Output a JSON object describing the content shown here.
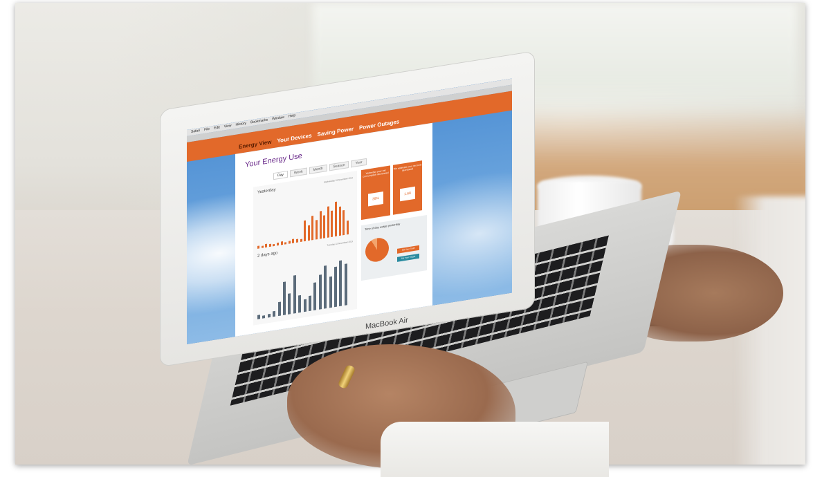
{
  "browser": {
    "menu": [
      "Safari",
      "File",
      "Edit",
      "View",
      "History",
      "Bookmarks",
      "Window",
      "Help"
    ]
  },
  "site": {
    "nav": [
      "Energy View",
      "Your Devices",
      "Saving Power",
      "Power Outages"
    ],
    "active_nav": "Energy View"
  },
  "panel": {
    "title": "Your Energy Use",
    "tabs": [
      "Day",
      "Week",
      "Month",
      "Season",
      "Year"
    ],
    "active_tab": "Day",
    "chart1_label": "Yesterday",
    "chart1_date": "Wednesday 23 November 2011",
    "chart2_label": "2 days ago",
    "chart2_date": "Tuesday 22 November 2011",
    "card1_text": "Yesterday your net consumption decreased",
    "card1_value": "39%",
    "card2_text": "We estimate your net cost decreased",
    "card2_value": "1.68",
    "tod_title": "Time of day usage yesterday",
    "tod_btn1": "Set Your Tariff",
    "tod_btn2": "Set Your Target"
  },
  "laptop": {
    "brand": "MacBook Air"
  },
  "colors": {
    "accent": "#e2692a",
    "title": "#6a2a8a",
    "secondary": "#5b6b7a"
  }
}
